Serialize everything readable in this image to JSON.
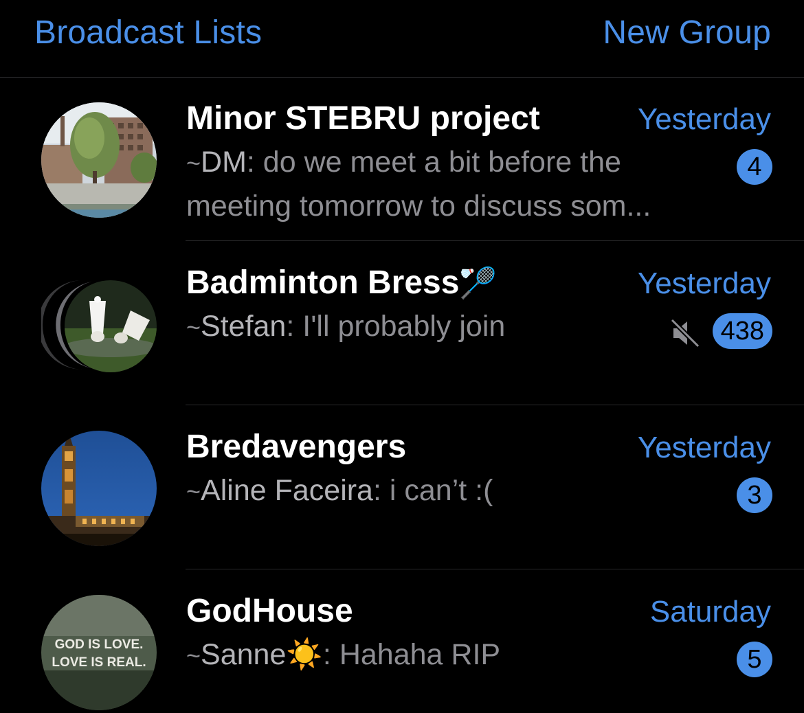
{
  "header": {
    "left_link": "Broadcast Lists",
    "right_link": "New Group"
  },
  "colors": {
    "accent": "#4a8fe8",
    "background": "#000000",
    "preview_text": "#8e8e93",
    "title_text": "#ffffff"
  },
  "chats": [
    {
      "title": "Minor STEBRU project",
      "time": "Yesterday",
      "tilde": "~",
      "sender": "DM",
      "message": ": do we meet a bit before the meeting tomorrow to discuss som...",
      "unread": "4",
      "muted": false,
      "avatar_icon": "building-photo-avatar"
    },
    {
      "title": "Badminton Bress",
      "title_emoji": "🏸",
      "time": "Yesterday",
      "tilde": "~",
      "sender": "Stefan",
      "message": ": I'll probably join",
      "unread": "438",
      "muted": true,
      "avatar_icon": "shuttlecock-photo-avatar"
    },
    {
      "title": "Bredavengers",
      "time": "Yesterday",
      "tilde": "~",
      "sender": "Aline Faceira",
      "message": ": i can’t :(",
      "unread": "3",
      "muted": false,
      "avatar_icon": "church-tower-photo-avatar"
    },
    {
      "title": "GodHouse",
      "time": "Saturday",
      "tilde": "~",
      "sender": "Sanne",
      "sender_emoji": "☀️",
      "message": ": Hahaha RIP",
      "unread": "5",
      "muted": false,
      "avatar_icon": "god-is-love-avatar",
      "avatar_text_1": "GOD IS LOVE.",
      "avatar_text_2": "LOVE IS REAL."
    }
  ]
}
